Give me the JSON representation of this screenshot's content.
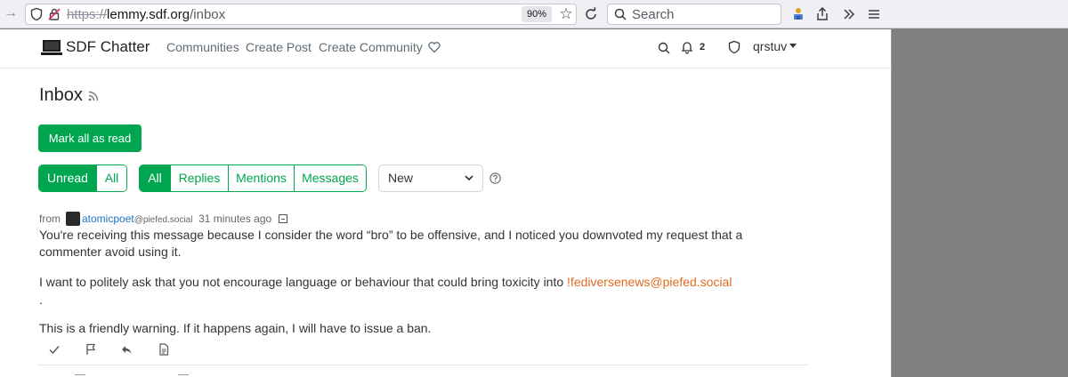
{
  "browser": {
    "url_scheme": "https://",
    "url_host": "lemmy.sdf.org",
    "url_path": "/inbox",
    "zoom": "90%",
    "search_placeholder": "Search",
    "icons": [
      "back-arrow-icon",
      "shield-icon",
      "lock-icon",
      "bookmark-star-icon",
      "reload-icon",
      "search-icon",
      "extension-icon",
      "share-icon",
      "overflow-icon",
      "menu-icon"
    ]
  },
  "nav": {
    "brand": "SDF Chatter",
    "links": [
      "Communities",
      "Create Post",
      "Create Community"
    ],
    "notification_count": "2",
    "username": "qrstuv"
  },
  "inbox": {
    "title": "Inbox",
    "mark_all_label": "Mark all as read",
    "read_filter": [
      {
        "label": "Unread",
        "active": true
      },
      {
        "label": "All",
        "active": false
      }
    ],
    "type_filter": [
      {
        "label": "All",
        "active": true
      },
      {
        "label": "Replies",
        "active": false
      },
      {
        "label": "Mentions",
        "active": false
      },
      {
        "label": "Messages",
        "active": false
      }
    ],
    "sort_value": "New"
  },
  "message": {
    "from_label": "from",
    "author": "atomicpoet",
    "author_instance": "@piefed.social",
    "time": "31 minutes ago",
    "para1": "You're receiving this message because I consider the word “bro” to be offensive, and I noticed you downvoted my request that a commenter avoid using it.",
    "para2_text": "I want to politely ask that you not encourage language or behaviour that could bring toxicity into ",
    "para2_link": "!fediversenews@piefed.social",
    "para2_end": ".",
    "para3": "This is a friendly warning. If it happens again, I will have to issue a ban."
  },
  "colors": {
    "accent": "#00a64f",
    "link": "#1e74c8",
    "community_link": "#e06b1f"
  }
}
